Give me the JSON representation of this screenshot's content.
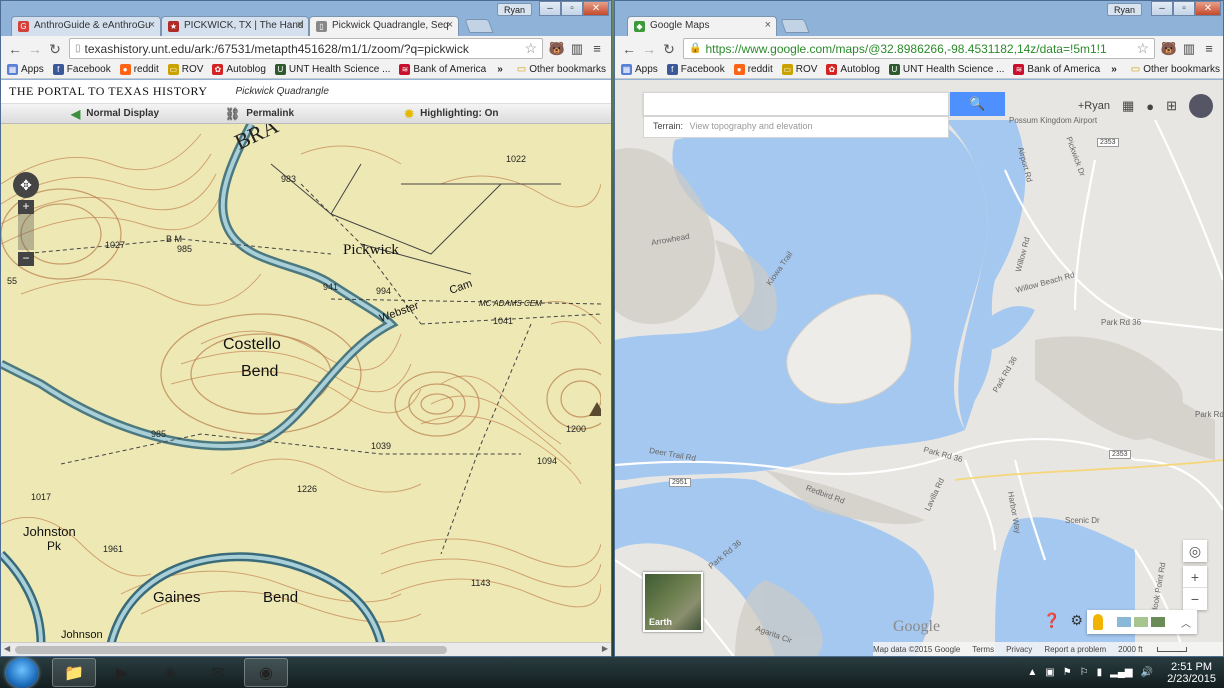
{
  "left_window": {
    "user": "Ryan",
    "tabs": [
      {
        "title": "AnthroGuide & eAnthroGu",
        "favicon_color": "#d4413a",
        "favicon": "G"
      },
      {
        "title": "PICKWICK, TX | The Hand",
        "favicon_color": "#b02a2a",
        "favicon": "★"
      },
      {
        "title": "Pickwick Quadrangle, Seq",
        "favicon_color": "#888888",
        "favicon": "▯"
      }
    ],
    "url": "texashistory.unt.edu/ark:/67531/metapth451628/m1/1/zoom/?q=pickwick",
    "portal_logo": "THE PORTAL TO TEXAS HISTORY",
    "document_title": "Pickwick Quadrangle",
    "toolbar": {
      "normal": "Normal Display",
      "permalink": "Permalink",
      "highlighting": "Highlighting: On"
    },
    "map_labels": {
      "bra": "BRA",
      "pickwick": "Pickwick",
      "costello": "Costello",
      "bend1": "Bend",
      "webster": "Webster",
      "cam": "Cam",
      "mcadams": "MC ADAMS CEM",
      "johnston": "Johnston",
      "pk": "Pk",
      "gaines": "Gaines",
      "bend2": "Bend",
      "johnson": "Johnson",
      "bm": "B M",
      "e985": "985",
      "e1027": "1027",
      "e983": "983",
      "e1022": "1022",
      "e941": "941",
      "e994": "994",
      "e1041": "1041",
      "e985b": "985",
      "e1039": "1039",
      "e1094": "1094",
      "e1017": "1017",
      "e1226": "1226",
      "e1200": "1200",
      "e1961": "1961",
      "e1143": "1143",
      "e55": "55"
    }
  },
  "right_window": {
    "user": "Ryan",
    "tabs": [
      {
        "title": "Google Maps",
        "favicon_color": "#3c9a3c",
        "favicon": "◆"
      }
    ],
    "url": "https://www.google.com/maps/@32.8986266,-98.4531182,14z/data=!5m1!1",
    "search": {
      "placeholder": "",
      "terrain_label": "Terrain:",
      "terrain_desc": "View topography and elevation"
    },
    "account": "+Ryan",
    "labels": {
      "possum": "Possum Kingdom Airport",
      "airport_rd": "Airport Rd",
      "pickwick_dr": "Pickwick Dr",
      "arrowhead": "Arrowhead",
      "kiowa": "Kiowa Trail",
      "willow": "Willow Rd",
      "willow_beach": "Willow Beach Rd",
      "park36a": "Park Rd 36",
      "park36b": "Park Rd 36",
      "park36c": "Park Rd 36",
      "park36d": "Park Rd 36",
      "deer_trail": "Deer Trail Rd",
      "redbird": "Redbird Rd",
      "lavilla": "Lavilla Rd",
      "harbor": "Harbor Way",
      "scenic": "Scenic Dr",
      "agarita": "Agarita Cir",
      "park36e": "Park Rd 36",
      "overlook": "Overlook Point Rd"
    },
    "shields": {
      "s2353a": "2353",
      "s2353b": "2353",
      "s2951": "2951"
    },
    "earth_label": "Earth",
    "logo": "Google",
    "footer": {
      "data": "Map data ©2015 Google",
      "terms": "Terms",
      "privacy": "Privacy",
      "report": "Report a problem",
      "scale": "2000 ft"
    }
  },
  "bookmarks": [
    {
      "label": "Apps",
      "color": "#5a7fd6",
      "icon": "▦"
    },
    {
      "label": "Facebook",
      "color": "#3b5998",
      "icon": "f"
    },
    {
      "label": "reddit",
      "color": "#ff6314",
      "icon": "●"
    },
    {
      "label": "ROV",
      "color": "#c9a200",
      "icon": "▭"
    },
    {
      "label": "Autoblog",
      "color": "#d42323",
      "icon": "✿"
    },
    {
      "label": "UNT Health Science ...",
      "color": "#2f5a2f",
      "icon": "U"
    },
    {
      "label": "Bank of America",
      "color": "#c8102e",
      "icon": "≋"
    }
  ],
  "bookmarks_other": "Other bookmarks",
  "taskbar": {
    "time": "2:51 PM",
    "date": "2/23/2015"
  }
}
